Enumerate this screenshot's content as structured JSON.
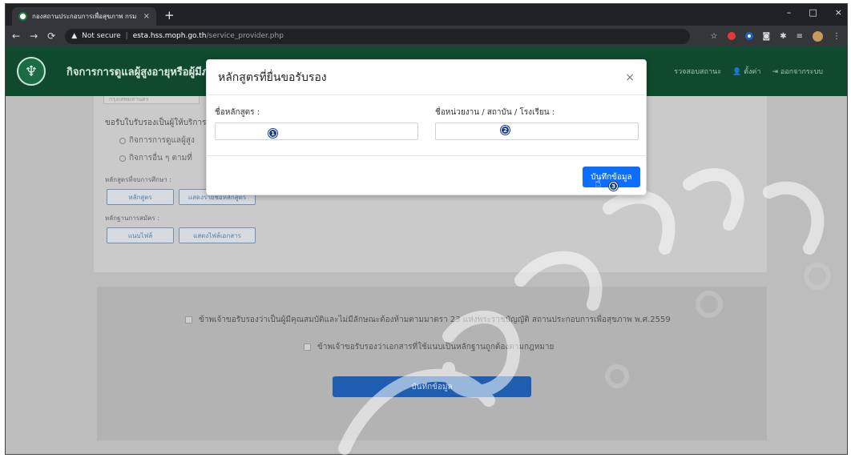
{
  "browser": {
    "tab_title": "กองสถานประกอบการเพื่อสุขภาพ กรม",
    "tab_close": "×",
    "new_tab": "+",
    "address": {
      "security_label": "Not secure",
      "host": "esta.hss.moph.go.th",
      "path": "/service_provider.php"
    },
    "window_controls": [
      "–",
      "□",
      "×"
    ]
  },
  "navbar": {
    "brand": "กิจการการดูแลผู้สูงอายุหรือผู้มีภา",
    "links": [
      "รวจสอบสถานะ",
      "ตั้งค่า",
      "ออกจากระบบ"
    ]
  },
  "background_form": {
    "province_input": "กรุงเทพมหานคร",
    "request_label": "ขอรับใบรับรองเป็นผู้ให้บริการ",
    "radio_1": "กิจการการดูแลผู้สูง",
    "radio_2": "กิจการอื่น ๆ ตามที่",
    "course_label": "หลักสูตรที่จบการศึกษา :",
    "course_btn": "หลักสูตร",
    "course_list_btn": "แสดงรายชื่อหลักสูตร",
    "evidence_label": "หลักฐานการสมัคร :",
    "attach_btn": "แนบไฟล์",
    "show_docs_btn": "แสดงไฟล์เอกสาร"
  },
  "footer": {
    "check_1": "ข้าพเจ้าขอรับรองว่าเป็นผู้มีคุณสมบัติและไม่มีลักษณะต้องห้ามตามมาตรา 23 แห่งพระราชบัญญัติ สถานประกอบการเพื่อสุขภาพ พ.ศ.2559",
    "check_2": "ข้าพเจ้าขอรับรองว่าเอกสารที่ใช้แนบเป็นหลักฐานถูกต้องตามกฎหมาย",
    "save_label": "บันทึกข้อมูล"
  },
  "modal": {
    "title": "หลักสูตรที่ยื่นขอรับรอง",
    "close": "×",
    "course_name_label": "ชื่อหลักสูตร :",
    "course_name_value": "",
    "org_label": "ชื่อหน่วยงาน / สถาบัน / โรงเรียน :",
    "org_value": "",
    "save_label": "บันทึกข้อมูล",
    "markers": [
      "1",
      "2",
      "3"
    ]
  },
  "colors": {
    "navbar": "#0f4a2f",
    "primary": "#0d6efd",
    "marker": "#1a3a8a"
  }
}
